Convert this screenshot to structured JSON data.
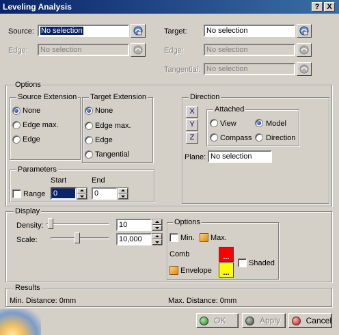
{
  "window": {
    "title": "Leveling Analysis",
    "help_label": "?",
    "close_label": "X"
  },
  "source": {
    "label": "Source:",
    "value": "No selection"
  },
  "target": {
    "label": "Target:",
    "value": "No selection"
  },
  "edge_left": {
    "label": "Edge:",
    "value": "No selection"
  },
  "edge_right": {
    "label": "Edge:",
    "value": "No selection"
  },
  "tangential": {
    "label": "Tangential:",
    "value": "No selection"
  },
  "options": {
    "title": "Options",
    "source_extension": {
      "title": "Source Extension",
      "items": [
        "None",
        "Edge max.",
        "Edge"
      ],
      "selected": "None"
    },
    "target_extension": {
      "title": "Target Extension",
      "items": [
        "None",
        "Edge max.",
        "Edge",
        "Tangential"
      ],
      "selected": "None"
    },
    "direction": {
      "title": "Direction",
      "axes": [
        "X",
        "Y",
        "Z"
      ],
      "attached": {
        "title": "Attached",
        "items": [
          "View",
          "Model",
          "Compass",
          "Direction"
        ],
        "selected": "Model"
      },
      "plane_label": "Plane:",
      "plane_value": "No selection"
    },
    "parameters": {
      "title": "Parameters",
      "range_label": "Range",
      "range_checked": false,
      "start_label": "Start",
      "end_label": "End",
      "start_value": "0",
      "end_value": "0"
    }
  },
  "display": {
    "title": "Display",
    "density_label": "Density:",
    "density_value": "10",
    "scale_label": "Scale:",
    "scale_value": "10,000",
    "options_title": "Options",
    "min_label": "Min.",
    "min_checked": false,
    "max_label": "Max.",
    "max_checked": true,
    "comb_label": "Comb",
    "comb_color": "#ff0000",
    "envelope_label": "Envelope",
    "envelope_checked": true,
    "envelope_color": "#ffff00",
    "shaded_label": "Shaded",
    "shaded_checked": false,
    "swatch_text": "..."
  },
  "results": {
    "title": "Results",
    "min_distance": "Min. Distance: 0mm",
    "max_distance": "Max. Distance: 0mm"
  },
  "buttons": {
    "ok": "OK",
    "apply": "Apply",
    "cancel": "Cancel"
  },
  "colors": {
    "title_bar": "#0a246a",
    "dialog_bg": "#d4d0c8",
    "selection": "#0a246a"
  }
}
